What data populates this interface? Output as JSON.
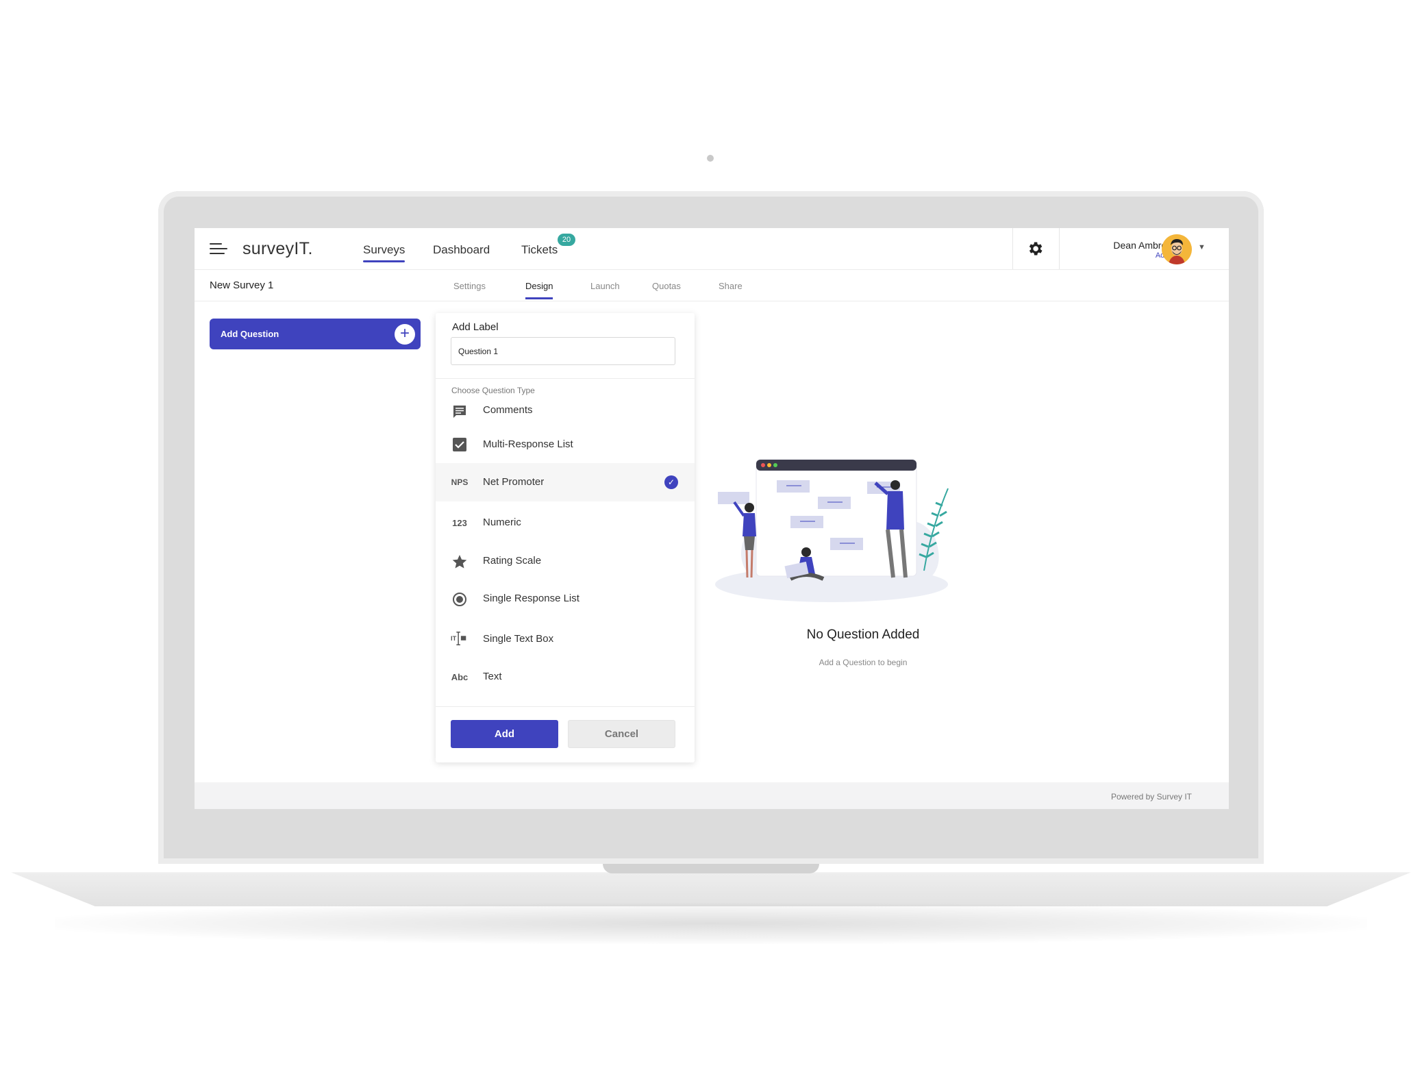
{
  "app": {
    "brand": "surveyIT.",
    "nav": [
      {
        "label": "Surveys",
        "active": true
      },
      {
        "label": "Dashboard",
        "active": false
      },
      {
        "label": "Tickets",
        "active": false,
        "badge": "20"
      }
    ],
    "user": {
      "name": "Dean Ambrose",
      "role": "Admin"
    }
  },
  "survey": {
    "title": "New Survey 1",
    "tabs": [
      {
        "label": "Settings",
        "active": false
      },
      {
        "label": "Design",
        "active": true
      },
      {
        "label": "Launch",
        "active": false
      },
      {
        "label": "Quotas",
        "active": false
      },
      {
        "label": "Share",
        "active": false
      }
    ]
  },
  "sidebar": {
    "add_question_label": "Add Question",
    "plus_icon": "plus-icon"
  },
  "panel": {
    "label_title": "Add Label",
    "label_value": "Question 1",
    "choose_title": "Choose Question Type",
    "types": [
      {
        "icon": "comment-icon",
        "glyph": "",
        "label": "Comments",
        "selected": false
      },
      {
        "icon": "checkbox-icon",
        "glyph": "",
        "label": "Multi-Response List",
        "selected": false
      },
      {
        "icon": "nps-icon",
        "glyph": "NPS",
        "label": "Net Promoter",
        "selected": true
      },
      {
        "icon": "numeric-icon",
        "glyph": "123",
        "label": "Numeric",
        "selected": false
      },
      {
        "icon": "star-icon",
        "glyph": "",
        "label": "Rating Scale",
        "selected": false
      },
      {
        "icon": "radio-icon",
        "glyph": "",
        "label": "Single Response List",
        "selected": false
      },
      {
        "icon": "text-box-icon",
        "glyph": "",
        "label": "Single Text Box",
        "selected": false
      },
      {
        "icon": "abc-icon",
        "glyph": "Abc",
        "label": "Text",
        "selected": false
      }
    ],
    "add_label": "Add",
    "cancel_label": "Cancel"
  },
  "empty_state": {
    "title": "No Question Added",
    "subtitle": "Add a Question to begin"
  },
  "footer": {
    "text": "Powered by Survey IT"
  },
  "colors": {
    "accent": "#3f43be",
    "badge": "#36a8a0",
    "footer_bg": "#f3f3f4"
  }
}
